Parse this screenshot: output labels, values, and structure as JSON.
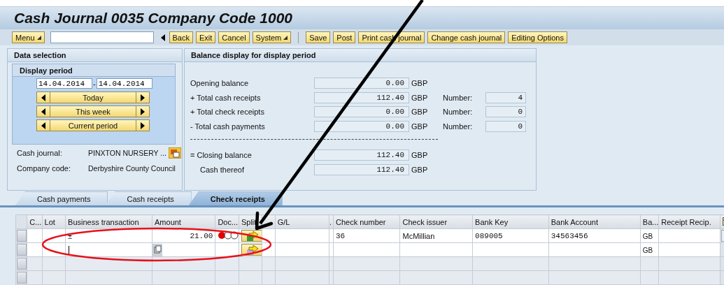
{
  "window": {
    "title": "Cash Journal 0035 Company Code 1000"
  },
  "toolbar": {
    "menu": "Menu",
    "buttons": [
      "Back",
      "Exit",
      "Cancel",
      "System"
    ],
    "app_buttons": [
      "Save",
      "Post",
      "Print cash journal",
      "Change cash journal",
      "Editing Options"
    ]
  },
  "data_selection": {
    "title": "Data selection",
    "display_period": {
      "title": "Display period",
      "from": "14.04.2014",
      "separator": "-",
      "to": "14.04.2014",
      "periods": [
        "Today",
        "This week",
        "Current period"
      ]
    },
    "fields": [
      {
        "label": "Cash journal:",
        "value": "PINXTON NURSERY ...",
        "kind": "lookup"
      },
      {
        "label": "Company code:",
        "value": "Derbyshire County Council",
        "kind": "text"
      }
    ]
  },
  "balance": {
    "title": "Balance display for display period",
    "rows": [
      {
        "label": "Opening balance",
        "amount": "0.00",
        "currency": "GBP",
        "kind": "plain"
      },
      {
        "label": "+ Total cash receipts",
        "amount": "112.40",
        "currency": "GBP",
        "number_label": "Number:",
        "number": "4",
        "kind": "plain"
      },
      {
        "label": "+ Total check receipts",
        "amount": "0.00",
        "currency": "GBP",
        "number_label": "Number:",
        "number": "0",
        "kind": "plain"
      },
      {
        "label": "- Total cash payments",
        "amount": "0.00",
        "currency": "GBP",
        "number_label": "Number:",
        "number": "0",
        "kind": "plain"
      },
      {
        "kind": "separator"
      },
      {
        "label": "= Closing balance",
        "amount": "112.40",
        "currency": "GBP",
        "kind": "plain"
      },
      {
        "label": "Cash thereof",
        "amount": "112.40",
        "currency": "GBP",
        "kind": "indented"
      }
    ]
  },
  "tabs": [
    {
      "label": "Cash payments",
      "selected": false
    },
    {
      "label": "Cash receipts",
      "selected": false
    },
    {
      "label": "Check receipts",
      "selected": true
    }
  ],
  "table": {
    "columns": [
      "C...",
      "Lot",
      "Business transaction",
      "Amount",
      "Doc...",
      "Split",
      "",
      "G/L",
      ".",
      "Check number",
      "Check issuer",
      "Bank Key",
      "Bank Account",
      "Ba...",
      "Receipt Recip."
    ],
    "rows": [
      {
        "kind": "filled",
        "business_transaction": "±",
        "amount": "21.00",
        "doc_status": {
          "color": "#e00000"
        },
        "check_number": "36",
        "check_issuer": "McMillian",
        "bank_key": "089005",
        "bank_account": "34563456",
        "bank_country": "GB"
      },
      {
        "kind": "input",
        "bank_country": "GB"
      },
      {
        "kind": "empty"
      },
      {
        "kind": "empty"
      }
    ]
  }
}
